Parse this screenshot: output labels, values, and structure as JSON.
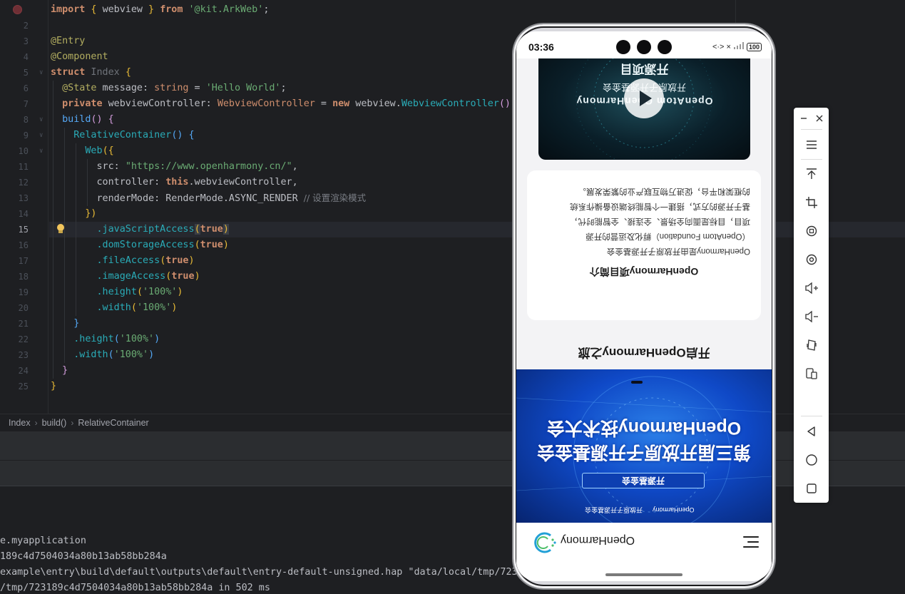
{
  "editor": {
    "line_numbers": [
      "",
      "2",
      "3",
      "4",
      "5",
      "6",
      "7",
      "8",
      "9",
      "10",
      "11",
      "12",
      "13",
      "14",
      "15",
      "16",
      "17",
      "18",
      "19",
      "20",
      "21",
      "22",
      "23",
      "24",
      "25"
    ],
    "code": {
      "l1_import": "import",
      "l1_open": " { ",
      "l1_name": "webview",
      "l1_close": " } ",
      "l1_from": "from",
      "l1_module": "'@kit.ArkWeb'",
      "l1_semi": ";",
      "l3_entry": "@Entry",
      "l4_component": "@Component",
      "l5_struct": "struct",
      "l5_name": " Index ",
      "l5_brace": "{",
      "l6_state": "@State",
      "l6_rest": " message: ",
      "l6_type": "string",
      "l6_eq": " = ",
      "l6_val": "'Hello World'",
      "l6_semi": ";",
      "l7_private": "private",
      "l7_field": " webviewController: ",
      "l7_type": "WebviewController",
      "l7_eq": " = ",
      "l7_new": "new",
      "l7_ns": " webview.",
      "l7_cls": "WebviewController",
      "l7_paren": "()",
      "l8_build": "build",
      "l8_paren": "() ",
      "l8_brace": "{",
      "l9_rc": "RelativeContainer",
      "l9_paren": "() ",
      "l9_brace": "{",
      "l10_web": "Web",
      "l10_open": "({",
      "l11_key": "src: ",
      "l11_val": "\"https://www.openharmony.cn/\"",
      "l11_comma": ",",
      "l12_key": "controller: ",
      "l12_this": "this",
      "l12_rest": ".webviewController,",
      "l13_key": "renderMode: RenderMode.ASYNC_RENDER ",
      "l13_comment": "// 设置渲染模式",
      "l14_close": "})",
      "l15_fn": ".javaScriptAccess",
      "l15_arg": "true",
      "l16_fn": ".domStorageAccess",
      "l16_arg": "true",
      "l17_fn": ".fileAccess",
      "l17_arg": "true",
      "l18_fn": ".imageAccess",
      "l18_arg": "true",
      "l19_fn": ".height",
      "l19_arg": "'100%'",
      "l20_fn": ".width",
      "l20_arg": "'100%'",
      "l21_close": "}",
      "l22_fn": ".height",
      "l22_arg": "'100%'",
      "l23_fn": ".width",
      "l23_arg": "'100%'",
      "l24_close": "}",
      "l25_close": "}"
    }
  },
  "breadcrumb": {
    "items": [
      "Index",
      "build()",
      "RelativeContainer"
    ]
  },
  "console": {
    "lines": [
      "e.myapplication",
      "189c4d7504034a80b13ab58bb284a",
      "example\\entry\\build\\default\\outputs\\default\\entry-default-unsigned.hap \"data/local/tmp/7231",
      "/tmp/723189c4d7504034a80b13ab58bb284a in 502 ms"
    ]
  },
  "phone": {
    "status_time": "03:36",
    "battery": "100",
    "signal_glyphs": "<·> ×",
    "webpage": {
      "video_line1": "开放原子开源基金会",
      "video_line2": "OpenAtom OpenHarmony",
      "video_line3": "开源项目",
      "description_title": "OpenHarmony项目简介",
      "description_lines": [
        "OpenHarmony是由开放原子开源基金会",
        "（OpenAtom Foundation）孵化及运营的开源",
        "项目，目标是面向全场景、全连接、全智能时代，",
        "基于开源的方式，搭建一个智能终端设备操作系统",
        "的框架和平台，促进万物互联产业的繁荣发展。"
      ],
      "section_title": "开启OpenHarmony之旅",
      "banner_line1": "第三届开放原子开源基金会",
      "banner_line2": "OpenHarmony技术大会",
      "banner_button": "开源基金会",
      "banner_logo_left": "OpenHarmony",
      "banner_logo_right": "开放原子开源基金会",
      "site_name": "OpenHarmony"
    },
    "accent_color": "#0f49c7"
  },
  "toolbar": {
    "icons": [
      "minimize-icon",
      "close-icon",
      "menu-icon",
      "pin-top-icon",
      "crop-icon",
      "rotate-icon",
      "screenshot-icon",
      "volume-up-icon",
      "volume-down-icon",
      "fold-icon",
      "multi-device-icon",
      "back-icon",
      "home-icon",
      "recents-icon"
    ]
  }
}
